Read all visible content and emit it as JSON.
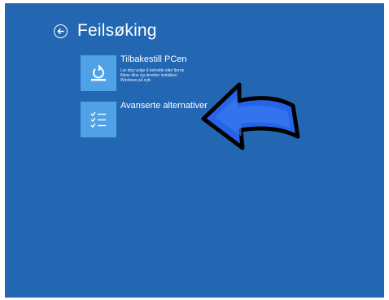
{
  "screen": {
    "title": "Feilsøking",
    "back_icon": "back-arrow-icon",
    "background": "#2367b3",
    "tile_color": "#4fa2e6"
  },
  "options": [
    {
      "title": "Tilbakestill PCen",
      "description_lines": [
        "Lar deg velge å beholde eller fjerne",
        "filene dine og deretter installere",
        "Windows på nytt."
      ],
      "icon": "reset-pc-icon"
    },
    {
      "title": "Avanserte alternativer",
      "icon": "checklist-icon"
    }
  ],
  "annotation": {
    "icon": "pointer-arrow-icon",
    "color": "#2563e8"
  }
}
